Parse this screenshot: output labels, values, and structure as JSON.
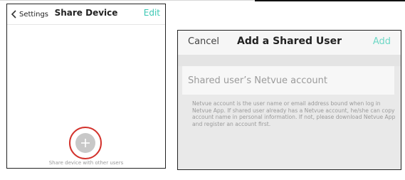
{
  "share_device_screen": {
    "back_label": "Settings",
    "title": "Share Device",
    "edit_label": "Edit",
    "add_caption": "Share device with other users",
    "icons": [
      "chevron-left-icon",
      "plus-icon"
    ],
    "accent_color": "#3cc8b4",
    "highlight_color": "#d3322c"
  },
  "add_shared_user_screen": {
    "cancel_label": "Cancel",
    "title": "Add a Shared User",
    "add_label": "Add",
    "account_placeholder": "Shared user’s Netvue account",
    "help_text": "Netvue account is the user name or email address bound when log in Netvue App. If shared user already has a Netvue account, he/she can copy account name in personal information. If not, please download Netvue App and register an account first."
  }
}
